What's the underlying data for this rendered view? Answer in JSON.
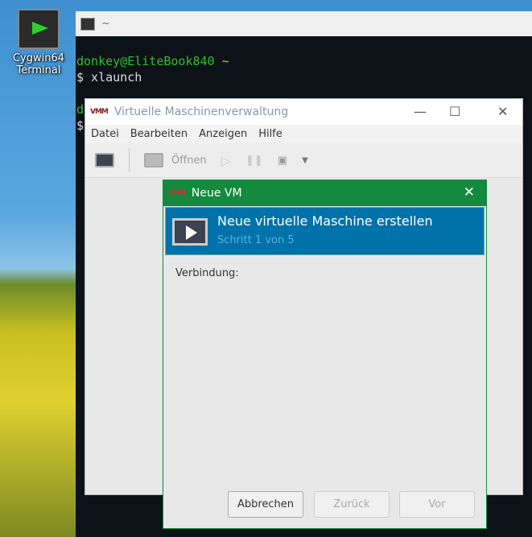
{
  "desktop": {
    "icon_label_1": "Cygwin64",
    "icon_label_2": "Terminal"
  },
  "terminal": {
    "title": "~",
    "lines": [
      {
        "prompt": "donkey@EliteBook840",
        "dir": "~"
      },
      {
        "cmd": "$ xlaunch"
      },
      {
        "partial": "d"
      },
      {
        "partial": "$"
      }
    ]
  },
  "manager": {
    "title": "Virtuelle Maschinenverwaltung",
    "menu": [
      "Datei",
      "Bearbeiten",
      "Anzeigen",
      "Hilfe"
    ],
    "open_label": "Öffnen"
  },
  "dialog": {
    "title": "Neue VM",
    "header_title": "Neue virtuelle Maschine erstellen",
    "step": "Schritt 1 von 5",
    "connection_label": "Verbindung:",
    "buttons": {
      "cancel": "Abbrechen",
      "back": "Zurück",
      "forward": "Vor"
    }
  }
}
